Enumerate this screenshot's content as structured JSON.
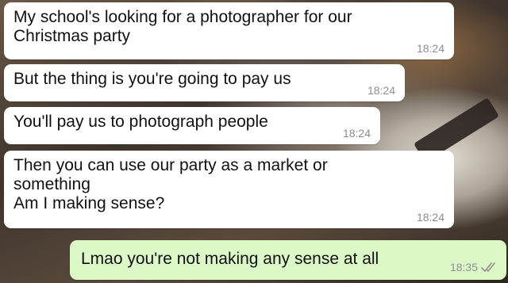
{
  "messages": [
    {
      "direction": "incoming",
      "text": "My school's looking for a photographer for our\nChristmas party",
      "time": "18:24"
    },
    {
      "direction": "incoming",
      "text": "But the thing is you're going to pay us",
      "time": "18:24"
    },
    {
      "direction": "incoming",
      "text": "You'll pay us to photograph people",
      "time": "18:24"
    },
    {
      "direction": "incoming",
      "text": "Then you can use our party as a market or\nsomething\nAm I making sense?",
      "time": "18:24"
    },
    {
      "direction": "outgoing",
      "text": "Lmao you're not making any sense at all",
      "time": "18:35",
      "status_icon": "double-check-icon"
    }
  ],
  "colors": {
    "incoming_bubble": "#ffffff",
    "outgoing_bubble": "#dcf8c6",
    "timestamp": "#8e8e8e",
    "read_ticks": "#8e8e8e"
  }
}
